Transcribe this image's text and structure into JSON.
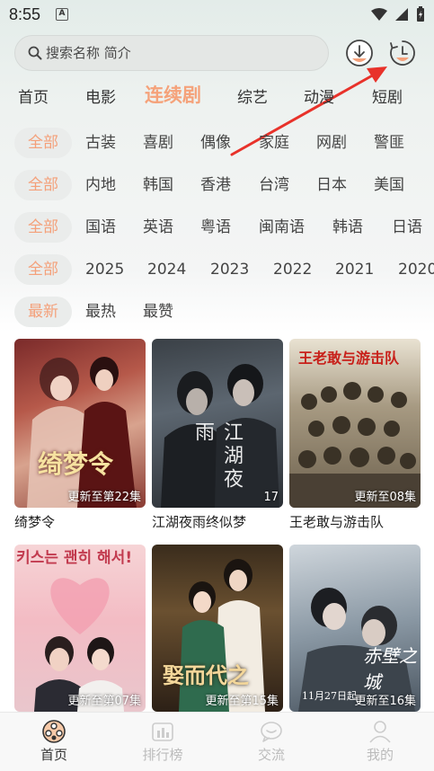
{
  "status_bar": {
    "time": "8:55",
    "badge": "A"
  },
  "search": {
    "placeholder": "搜索名称 简介"
  },
  "header_icons": {
    "download": "download-icon",
    "history": "history-icon"
  },
  "main_tabs": [
    {
      "label": "首页"
    },
    {
      "label": "电影"
    },
    {
      "label": "连续剧",
      "active": true
    },
    {
      "label": "综艺"
    },
    {
      "label": "动漫"
    },
    {
      "label": "短剧"
    }
  ],
  "filters": {
    "genre": {
      "all": "全部",
      "items": [
        "古装",
        "喜剧",
        "偶像",
        "家庭",
        "网剧",
        "警匪"
      ]
    },
    "region": {
      "all": "全部",
      "items": [
        "内地",
        "韩国",
        "香港",
        "台湾",
        "日本",
        "美国"
      ]
    },
    "language": {
      "all": "全部",
      "items": [
        "国语",
        "英语",
        "粤语",
        "闽南语",
        "韩语",
        "日语"
      ]
    },
    "year": {
      "all": "全部",
      "items": [
        "2025",
        "2024",
        "2023",
        "2022",
        "2021",
        "2020"
      ]
    },
    "sort": {
      "all": "最新",
      "items": [
        "最热",
        "最赞"
      ]
    }
  },
  "shows": [
    {
      "title": "绮梦令",
      "badge": "更新至第22集",
      "art": "绮梦令"
    },
    {
      "title": "江湖夜雨终似梦",
      "badge": "17",
      "art": "江湖夜雨"
    },
    {
      "title": "王老敢与游击队",
      "badge": "更新至08集",
      "art": "王老敢与游击队"
    },
    {
      "title": "",
      "badge": "更新至第07集",
      "art": "키스는 괜히 해서!"
    },
    {
      "title": "",
      "badge": "更新至第15集",
      "art": "娶而代之"
    },
    {
      "title": "",
      "badge": "更新至16集",
      "art": "赤壁之城",
      "extra": "11月27日起"
    }
  ],
  "bottom_nav": [
    {
      "label": "首页",
      "icon": "home-film-icon",
      "active": true
    },
    {
      "label": "排行榜",
      "icon": "ranking-icon"
    },
    {
      "label": "交流",
      "icon": "chat-icon"
    },
    {
      "label": "我的",
      "icon": "profile-icon"
    }
  ],
  "colors": {
    "accent": "#f5a27a",
    "arrow": "#e8322a"
  }
}
